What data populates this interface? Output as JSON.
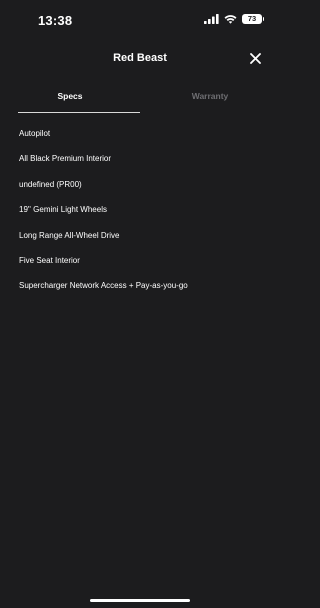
{
  "status_bar": {
    "time": "13:38",
    "battery": "73",
    "icons": [
      "signal-icon",
      "wifi-icon",
      "battery-icon"
    ]
  },
  "header": {
    "title": "Red Beast",
    "close_icon": "close-icon"
  },
  "tabs": [
    {
      "label": "Specs",
      "active": true
    },
    {
      "label": "Warranty",
      "active": false
    }
  ],
  "specs": [
    "Autopilot",
    "All Black Premium Interior",
    "undefined (PR00)",
    "19'' Gemini Light Wheels",
    "Long Range All-Wheel Drive",
    "Five Seat Interior",
    "Supercharger Network Access + Pay-as-you-go"
  ],
  "colors": {
    "background": "#1c1c1e",
    "text": "#ffffff",
    "inactive_tab": "#6e6e72",
    "underline": "#d9d9d9"
  }
}
